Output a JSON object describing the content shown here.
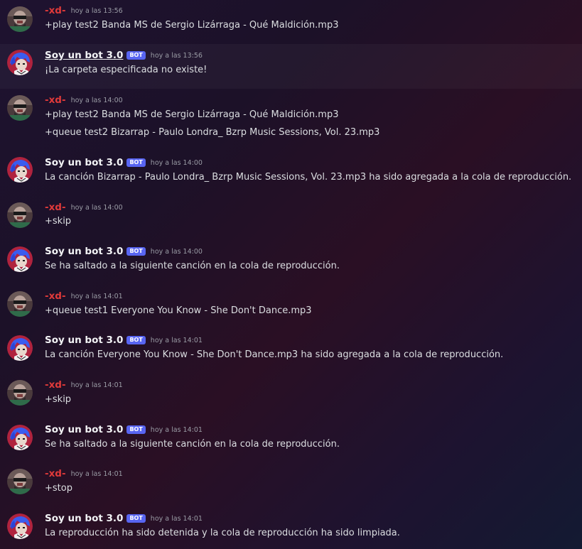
{
  "messages": [
    {
      "author": "-xd-",
      "type": "user",
      "timestamp": "hoy a las 13:56",
      "lines": [
        "+play test2 Banda MS de Sergio Lizárraga - Qué Maldición.mp3"
      ]
    },
    {
      "author": "Soy un bot 3.0",
      "type": "bot",
      "bot_tag": "BOT",
      "timestamp": "hoy a las 13:56",
      "lines": [
        "¡La carpeta especificada no existe!"
      ]
    },
    {
      "author": "-xd-",
      "type": "user",
      "timestamp": "hoy a las 14:00",
      "lines": [
        "+play test2 Banda MS de Sergio Lizárraga - Qué Maldición.mp3",
        "+queue test2 Bizarrap - Paulo Londra_ Bzrp Music Sessions, Vol. 23.mp3"
      ]
    },
    {
      "author": "Soy un bot 3.0",
      "type": "bot",
      "bot_tag": "BOT",
      "timestamp": "hoy a las 14:00",
      "lines": [
        "La canción Bizarrap - Paulo Londra_ Bzrp Music Sessions, Vol. 23.mp3 ha sido agregada a la cola de reproducción."
      ]
    },
    {
      "author": "-xd-",
      "type": "user",
      "timestamp": "hoy a las 14:00",
      "lines": [
        "+skip"
      ]
    },
    {
      "author": "Soy un bot 3.0",
      "type": "bot",
      "bot_tag": "BOT",
      "timestamp": "hoy a las 14:00",
      "lines": [
        "Se ha saltado a la siguiente canción en la cola de reproducción."
      ]
    },
    {
      "author": "-xd-",
      "type": "user",
      "timestamp": "hoy a las 14:01",
      "lines": [
        "+queue test1 Everyone You Know - She Don't Dance.mp3"
      ]
    },
    {
      "author": "Soy un bot 3.0",
      "type": "bot",
      "bot_tag": "BOT",
      "timestamp": "hoy a las 14:01",
      "lines": [
        "La canción Everyone You Know - She Don't Dance.mp3 ha sido agregada a la cola de reproducción."
      ]
    },
    {
      "author": "-xd-",
      "type": "user",
      "timestamp": "hoy a las 14:01",
      "lines": [
        "+skip"
      ]
    },
    {
      "author": "Soy un bot 3.0",
      "type": "bot",
      "bot_tag": "BOT",
      "timestamp": "hoy a las 14:01",
      "lines": [
        "Se ha saltado a la siguiente canción en la cola de reproducción."
      ]
    },
    {
      "author": "-xd-",
      "type": "user",
      "timestamp": "hoy a las 14:01",
      "lines": [
        "+stop"
      ]
    },
    {
      "author": "Soy un bot 3.0",
      "type": "bot",
      "bot_tag": "BOT",
      "timestamp": "hoy a las 14:01",
      "lines": [
        "La reproducción ha sido detenida y la cola de reproducción ha sido limpiada."
      ]
    }
  ],
  "colors": {
    "user_name": "#e03a3a",
    "bot_name": "#f2f3f5",
    "bot_tag": "#5865f2",
    "text": "#dbdee1",
    "timestamp": "#9a9ca5"
  },
  "avatars": {
    "user": "masked-person-avatar-icon",
    "bot": "blue-hair-character-avatar-icon"
  }
}
